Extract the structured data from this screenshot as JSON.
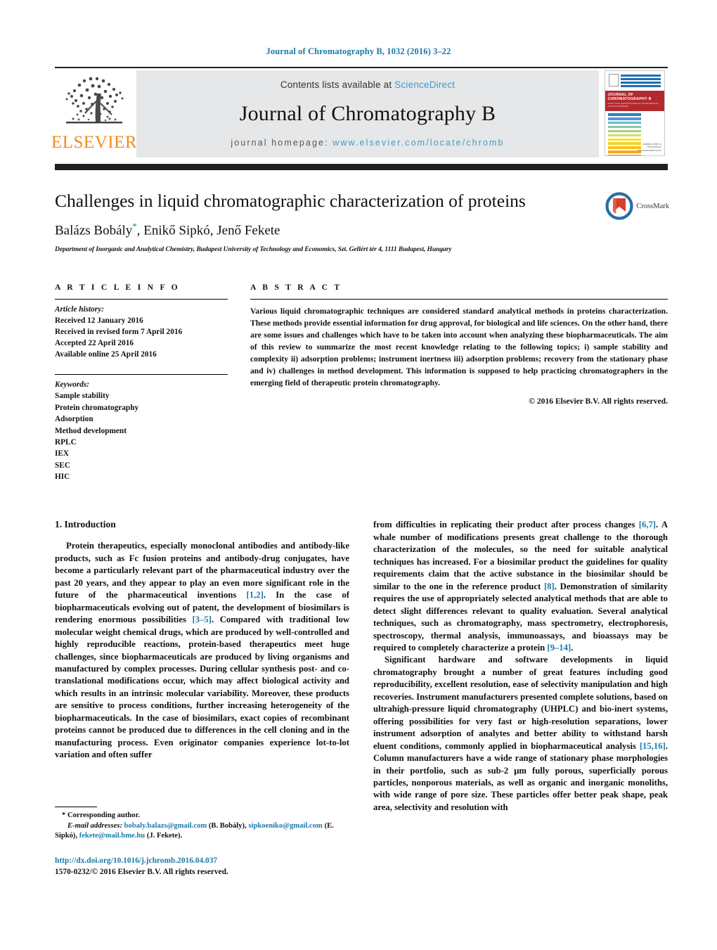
{
  "running_head": "Journal of Chromatography B, 1032 (2016) 3–22",
  "masthead": {
    "publisher_name": "ELSEVIER",
    "contents_prefix": "Contents lists available at ",
    "contents_link": "ScienceDirect",
    "journal_title": "Journal of Chromatography B",
    "homepage_prefix": "journal homepage: ",
    "homepage_url": "www.elsevier.com/locate/chromb",
    "cover": {
      "banner_title": "JOURNAL OF CHROMATOGRAPHY B",
      "banner_subtitle": "ANALYTICAL TECHNOLOGIES IN THE BIOMEDICAL AND LIFE SCIENCES",
      "footer_line1": "Available online at",
      "footer_line2": "ScienceDirect",
      "footer_line3": "www.sciencedirect.com"
    }
  },
  "article": {
    "title": "Challenges in liquid chromatographic characterization of proteins",
    "authors": "Balázs Bobály",
    "authors_rest": ", Enikő Sipkó, Jenő Fekete",
    "corresponding_marker": "*",
    "affiliation": "Department of Inorganic and Analytical Chemistry, Budapest University of Technology and Economics, Szt. Gellért tér 4, 1111 Budapest, Hungary",
    "crossmark_label": "CrossMark"
  },
  "article_info": {
    "heading": "A R T I C L E  I N F O",
    "history_label": "Article history:",
    "history": [
      "Received 12 January 2016",
      "Received in revised form 7 April 2016",
      "Accepted 22 April 2016",
      "Available online 25 April 2016"
    ],
    "keywords_label": "Keywords:",
    "keywords": [
      "Sample stability",
      "Protein chromatography",
      "Adsorption",
      "Method development",
      "RPLC",
      "IEX",
      "SEC",
      "HIC"
    ]
  },
  "abstract": {
    "heading": "A B S T R A C T",
    "text": "Various liquid chromatographic techniques are considered standard analytical methods in proteins characterization. These methods provide essential information for drug approval, for biological and life sciences. On the other hand, there are some issues and challenges which have to be taken into account when analyzing these biopharmaceuticals. The aim of this review to summarize the most recent knowledge relating to the following topics; i) sample stability and complexity ii) adsorption problems; instrument inertness iii) adsorption problems; recovery from the stationary phase and iv) challenges in method development. This information is supposed to help practicing chromatographers in the emerging field of therapeutic protein chromatography.",
    "copyright": "© 2016 Elsevier B.V. All rights reserved."
  },
  "body": {
    "section_heading": "1.  Introduction",
    "left_para_1_a": "Protein therapeutics, especially monoclonal antibodies and antibody-like products, such as Fc fusion proteins and antibody-drug conjugates, have become a particularly relevant part of the pharmaceutical industry over the past 20 years, and they appear to play an even more significant role in the future of the pharmaceutical inventions ",
    "left_ref_1": "[1,2]",
    "left_para_1_b": ". In the case of biopharmaceuticals evolving out of patent, the development of biosimilars is rendering enormous possibilities ",
    "left_ref_2": "[3–5]",
    "left_para_1_c": ". Compared with traditional low molecular weight chemical drugs, which are produced by well-controlled and highly reproducible reactions, protein-based therapeutics meet huge challenges, since biopharmaceuticals are produced by living organisms and manufactured by complex processes. During cellular synthesis post- and co-translational modifications occur, which may affect biological activity and which results in an intrinsic molecular variability. Moreover, these products are sensitive to process conditions, further increasing heterogeneity of the biopharmaceuticals. In the case of biosimilars, exact copies of recombinant proteins cannot be produced due to differences in the cell cloning and in the manufacturing process. Even originator companies experience lot-to-lot variation and often suffer",
    "right_para_1_a": "from difficulties in replicating their product after process changes ",
    "right_ref_1": "[6,7]",
    "right_para_1_b": ". A whale number of modifications presents great challenge to the thorough characterization of the molecules, so the need for suitable analytical techniques has increased. For a biosimilar product the guidelines for quality requirements claim that the active substance in the biosimilar should be similar to the one in the reference product ",
    "right_ref_2": "[8]",
    "right_para_1_c": ". Demonstration of similarity requires the use of appropriately selected analytical methods that are able to detect slight differences relevant to quality evaluation. Several analytical techniques, such as chromatography, mass spectrometry, electrophoresis, spectroscopy, thermal analysis, immunoassays, and bioassays may be required to completely characterize a protein ",
    "right_ref_3": "[9–14]",
    "right_para_1_d": ".",
    "right_para_2_a": "Significant hardware and software developments in liquid chromatography brought a number of great features including good reproducibility, excellent resolution, ease of selectivity manipulation and high recoveries. Instrument manufacturers presented complete solutions, based on ultrahigh-pressure liquid chromatography (UHPLC) and bio-inert systems, offering possibilities for very fast or high-resolution separations, lower instrument adsorption of analytes and better ability to withstand harsh eluent conditions, commonly applied in biopharmaceutical analysis ",
    "right_ref_4": "[15,16]",
    "right_para_2_b": ". Column manufacturers have a wide range of stationary phase morphologies in their portfolio, such as sub-2 μm fully porous, superficially porous particles, nonporous materials, as well as organic and inorganic monoliths, with wide range of pore size. These particles offer better peak shape, peak area, selectivity and resolution with"
  },
  "footnote": {
    "corresponding": "* Corresponding author.",
    "email_label": "E-mail addresses:",
    "email_1": "bobaly.balazs@gmail.com",
    "email_1_owner": " (B. Bobály), ",
    "email_2": "sipkoeniko@gmail.com",
    "email_2_owner": " (E. Sipkó), ",
    "email_3": "fekete@mail.bme.hu",
    "email_3_owner": " (J. Fekete)."
  },
  "doi": {
    "url": "http://dx.doi.org/10.1016/j.jchromb.2016.04.037",
    "issn_line": "1570-0232/© 2016 Elsevier B.V. All rights reserved."
  },
  "colors": {
    "link_blue": "#1a7aa8",
    "elsevier_orange": "#f08c1f",
    "dark_bar": "#231f20",
    "masthead_grey": "#e6e7e8",
    "cover_red": "#b2292e"
  }
}
